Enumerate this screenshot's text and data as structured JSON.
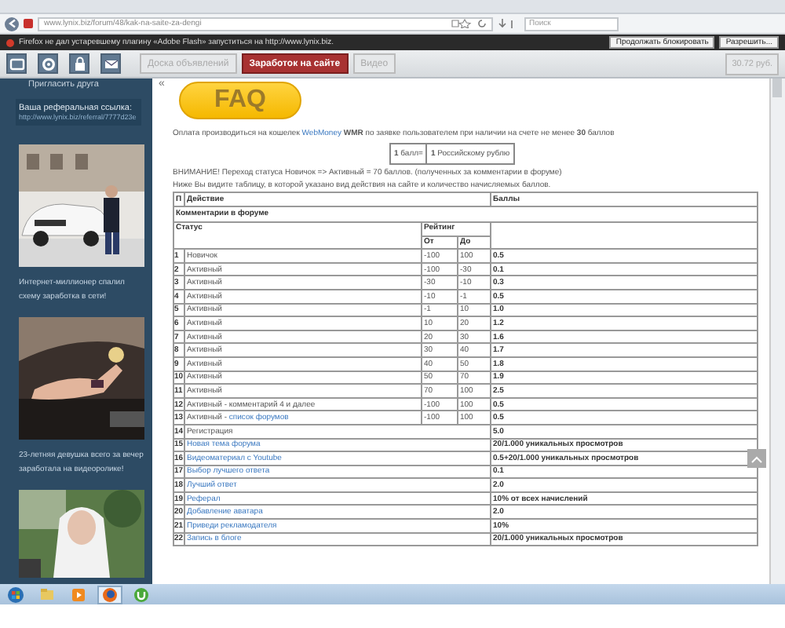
{
  "browser": {
    "address": "www.lynix.biz/forum/48/kak-na-saite-za-dengi",
    "search_placeholder": "Поиск",
    "notification": {
      "text": "Firefox не дал устаревшему плагину «Adobe Flash» запуститься на http://www.lynix.biz.",
      "buttons": [
        "Продолжать блокировать",
        "Разрешить..."
      ]
    }
  },
  "toolbar": {
    "tabs": [
      {
        "label": "Доска объявлений",
        "selected": false
      },
      {
        "label": "Заработок на сайте",
        "selected": true
      },
      {
        "label": "Видео",
        "selected": false
      }
    ],
    "balance": "30.72 руб."
  },
  "sidebar": {
    "invite": "Пригласить друга",
    "referral": {
      "label": "Ваша реферальная ссылка:",
      "url": "http://www.lynix.biz/referral/7777d23e"
    },
    "promos": [
      {
        "kind": "picture",
        "caption": "Интернет-миллионер спалил схему заработка в сети!"
      },
      {
        "kind": "picture",
        "caption": "23-летняя девушка всего за вечер заработала на видеоролике!"
      },
      {
        "kind": "picture"
      }
    ]
  },
  "content": {
    "collapse": "«",
    "faq_button": "FAQ",
    "intro": {
      "before": "Оплата производиться на кошелек ",
      "link": "WebMoney",
      "after": " **WMR** по заявке пользователем при наличии на счете не менее **30** баллов"
    },
    "rate": [
      "**1** балл=",
      "**1** Российскому рублю"
    ],
    "notes": [
      "ВНИМАНИЕ! Переход статуса Новичок => Активный = 70 баллов. (полученных за комментарии в форуме)",
      "Ниже Вы видите таблицу, в которой указано вид действия на сайте и количество начисляемых баллов."
    ],
    "table": {
      "num_header": "П",
      "action_header": "Действие",
      "points_header": "Баллы",
      "section": "Комментарии в форуме",
      "status_header": "Статус",
      "rating_header": "Рейтинг",
      "from_header": "От",
      "to_header": "До",
      "rows": [
        {
          "n": "1",
          "action": "Новичок",
          "from": "-100",
          "to": "100",
          "points": "0.5"
        },
        {
          "n": "2",
          "action": "Активный",
          "from": "-100",
          "to": "-30",
          "points": "0.1"
        },
        {
          "n": "3",
          "action": "Активный",
          "from": "-30",
          "to": "-10",
          "points": "0.3"
        },
        {
          "n": "4",
          "action": "Активный",
          "from": "-10",
          "to": "-1",
          "points": "0.5"
        },
        {
          "n": "5",
          "action": "Активный",
          "from": "-1",
          "to": "10",
          "points": "1.0"
        },
        {
          "n": "6",
          "action": "Активный",
          "from": "10",
          "to": "20",
          "points": "1.2"
        },
        {
          "n": "7",
          "action": "Активный",
          "from": "20",
          "to": "30",
          "points": "1.6"
        },
        {
          "n": "8",
          "action": "Активный",
          "from": "30",
          "to": "40",
          "points": "1.7"
        },
        {
          "n": "9",
          "action": "Активный",
          "from": "40",
          "to": "50",
          "points": "1.8"
        },
        {
          "n": "10",
          "action": "Активный",
          "from": "50",
          "to": "70",
          "points": "1.9"
        },
        {
          "n": "11",
          "action": "Активный",
          "from": "70",
          "to": "100",
          "points": "2.5"
        },
        {
          "n": "12",
          "action": "Активный - комментарий 4 и далее",
          "from": "-100",
          "to": "100",
          "points": "0.5"
        },
        {
          "n": "13",
          "action": "Активный - ",
          "link": "список форумов",
          "from": "-100",
          "to": "100",
          "points": "0.5"
        },
        {
          "n": "14",
          "action": "Регистрация",
          "points": "5.0"
        },
        {
          "n": "15",
          "link": "Новая тема форума",
          "points": "20/1.000 уникальных просмотров"
        },
        {
          "n": "16",
          "link": "Видеоматериал с Youtube",
          "points": "0.5+20/1.000 уникальных просмотров"
        },
        {
          "n": "17",
          "link": "Выбор лучшего ответа",
          "points": "0.1"
        },
        {
          "n": "18",
          "link": "Лучший ответ",
          "points": "2.0"
        },
        {
          "n": "19",
          "link": "Реферал",
          "points": "10% от всех начислений"
        },
        {
          "n": "20",
          "link": "Добавление аватара",
          "points": "2.0"
        },
        {
          "n": "21",
          "link": "Приведи рекламодателя",
          "points": "10%"
        },
        {
          "n": "22",
          "link": "Запись в блоге",
          "points": "20/1.000 уникальных просмотров"
        }
      ]
    }
  },
  "taskbar": {
    "apps": [
      {
        "kind": "folder",
        "selected": false
      },
      {
        "kind": "media",
        "selected": false
      },
      {
        "kind": "browser",
        "selected": true
      },
      {
        "kind": "torrent",
        "selected": false
      }
    ]
  }
}
